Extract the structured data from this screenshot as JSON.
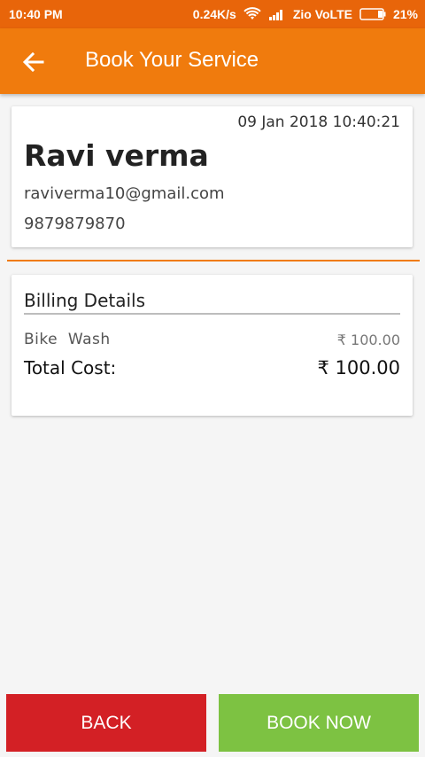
{
  "status_bar": {
    "time": "10:40 PM",
    "speed": "0.24K/s",
    "carrier": "Zio VoLTE",
    "battery": "21%"
  },
  "app_bar": {
    "title": "Book Your Service"
  },
  "user": {
    "datetime": "09 Jan 2018 10:40:21",
    "name": "Ravi verma",
    "email": "raviverma10@gmail.com",
    "phone": "9879879870"
  },
  "billing": {
    "title": "Billing Details",
    "item_name": "Bike  Wash",
    "item_price": "₹ 100.00",
    "total_label": "Total Cost:",
    "total_price": "₹ 100.00"
  },
  "buttons": {
    "back": "BACK",
    "book": "BOOK NOW"
  },
  "colors": {
    "status_bar": "#e8650a",
    "app_bar": "#f07b0d",
    "back_button": "#d32025",
    "book_button": "#7dc242"
  }
}
